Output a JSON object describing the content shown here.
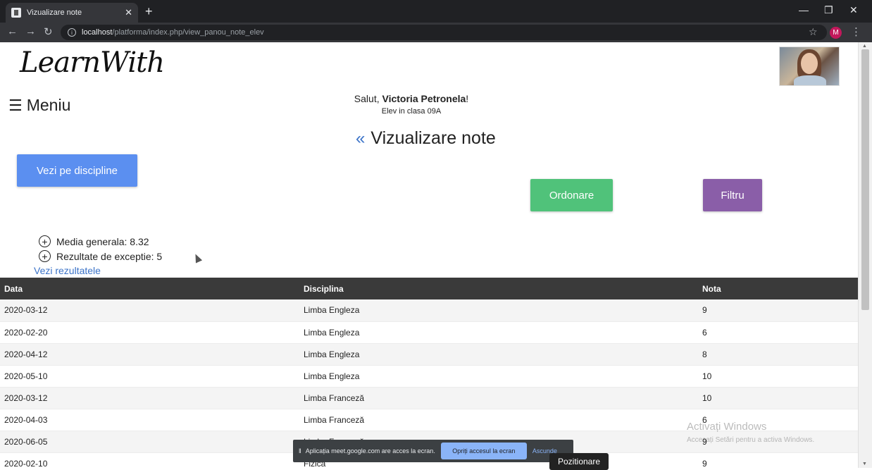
{
  "browser": {
    "tab_title": "Vizualizare note",
    "tab_close": "✕",
    "new_tab": "+",
    "url_host": "localhost",
    "url_path": "/platforma/index.php/view_panou_note_elev",
    "profile_initial": "M"
  },
  "header": {
    "logo": "LearnWith",
    "menu_label": "Meniu",
    "greeting_prefix": "Salut, ",
    "user_name": "Victoria Petronela",
    "greeting_suffix": "!",
    "class_info": "Elev in clasa 09A"
  },
  "page": {
    "title": "Vizualizare note",
    "btn_by_subject": "Vezi pe discipline",
    "btn_sort": "Ordonare",
    "btn_filter": "Filtru"
  },
  "stats": {
    "average": "Media generala: 8.32",
    "exceptional": "Rezultate de exceptie: 5",
    "view_results": "Vezi rezultatele"
  },
  "table": {
    "headers": [
      "Data",
      "Disciplina",
      "Nota"
    ],
    "rows": [
      [
        "2020-03-12",
        "Limba Engleza",
        "9"
      ],
      [
        "2020-02-20",
        "Limba Engleza",
        "6"
      ],
      [
        "2020-04-12",
        "Limba Engleza",
        "8"
      ],
      [
        "2020-05-10",
        "Limba Engleza",
        "10"
      ],
      [
        "2020-03-12",
        "Limba Franceză",
        "10"
      ],
      [
        "2020-04-03",
        "Limba Franceză",
        "6"
      ],
      [
        "2020-06-05",
        "Limba Franceză",
        "9"
      ],
      [
        "2020-02-10",
        "Fizica",
        "9"
      ]
    ]
  },
  "overlay": {
    "share_text": "Aplicația meet.google.com are acces la ecran.",
    "share_stop": "Opriți accesul la ecran",
    "share_hide": "Ascunde",
    "tooltip": "Pozitionare",
    "watermark_title": "Activați Windows",
    "watermark_sub": "Accesați Setări pentru a activa Windows."
  }
}
